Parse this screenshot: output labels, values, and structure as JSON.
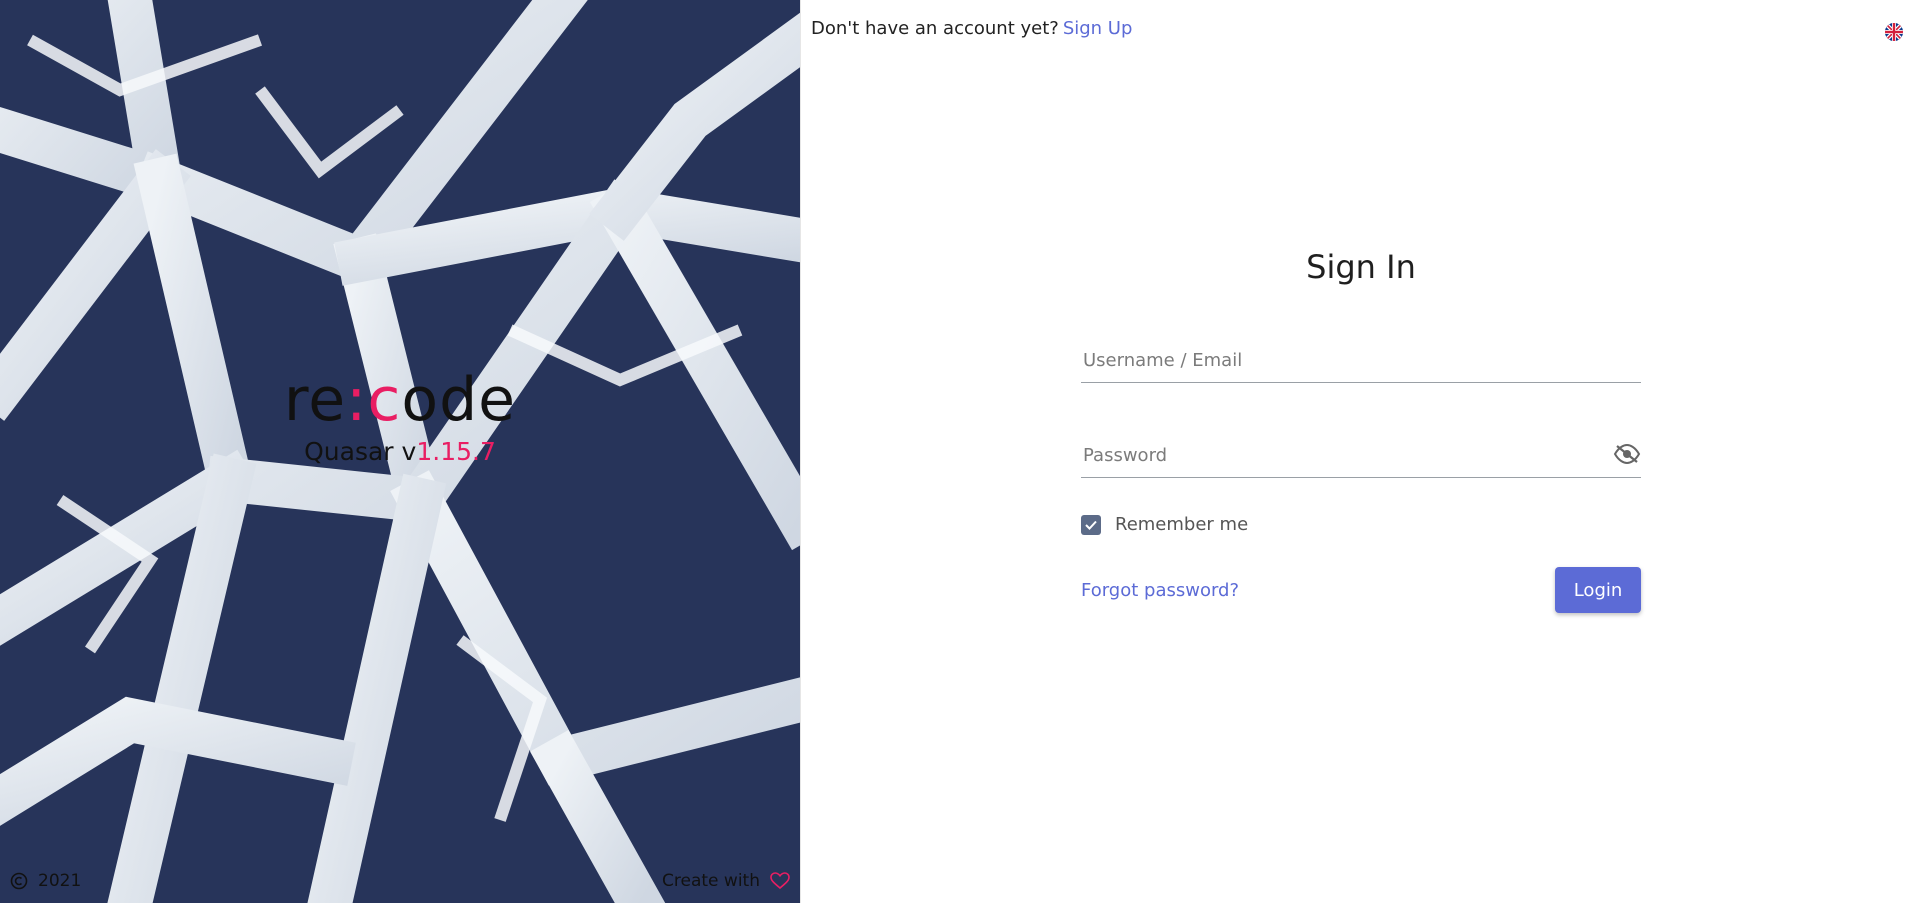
{
  "hero": {
    "logo_prefix": "re",
    "logo_accent": ":c",
    "logo_suffix": "ode",
    "version_prefix": "Quasar v",
    "version_number": "1.15.7",
    "footer_year": "2021",
    "footer_create_with": "Create with"
  },
  "topbar": {
    "question": "Don't have an account yet?",
    "signup_link": "Sign Up",
    "language_icon": "uk-flag-icon"
  },
  "form": {
    "title": "Sign In",
    "username_placeholder": "Username / Email",
    "password_placeholder": "Password",
    "remember_label": "Remember me",
    "forgot_link": "Forgot password?",
    "login_label": "Login"
  },
  "colors": {
    "accent": "#e91e63",
    "primary": "#5c6bd6",
    "checkbox": "#5c6b88"
  }
}
